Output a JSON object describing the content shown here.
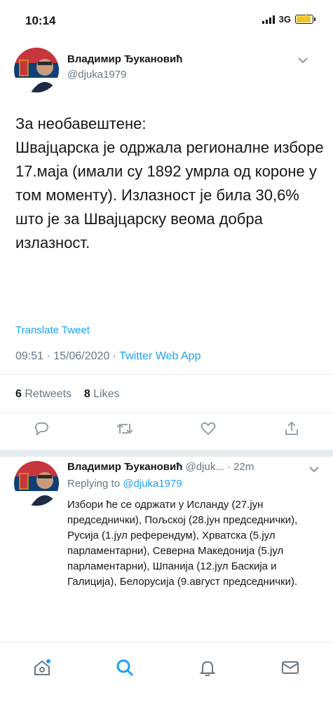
{
  "status_bar": {
    "time": "10:14",
    "network": "3G"
  },
  "main_tweet": {
    "author_name": "Владимир Ђукановић",
    "author_handle": "@djuka1979",
    "text": "За необавештене:\nШвајцарска је одржала регионалне изборе 17.маја (имали су 1892 умрла од короне у том моменту). Излазност је била 30,6% што је за Швајцарску веома добра излазност.",
    "translate_label": "Translate Tweet",
    "timestamp": "09:51 · 15/06/2020 · ",
    "source": "Twitter Web App",
    "retweets_count": "6",
    "retweets_label": "Retweets",
    "likes_count": "8",
    "likes_label": "Likes"
  },
  "reply_tweet": {
    "author_name": "Владимир Ђукановић",
    "author_handle": "@djuk...",
    "time_ago": "· 22m",
    "replying_to_label": "Replying to ",
    "replying_to_handle": "@djuka1979",
    "text": "Избори ће се одржати у Исланду (27.јун председнички), Пољској (28.јун председнички), Русија (1.јул референдум),  Хрватска (5.јул парламентарни), Северна Македонија (5.јул парламентарни), Шпанија (12.јул Баскија и Галиција), Белорусија (9.август председнички)."
  },
  "colors": {
    "accent": "#1da1f2",
    "muted": "#657786",
    "divider": "#e6ecf0"
  },
  "icons": [
    "reply-icon",
    "retweet-icon",
    "like-icon",
    "share-icon",
    "home-icon",
    "search-icon",
    "notifications-icon",
    "messages-icon"
  ]
}
